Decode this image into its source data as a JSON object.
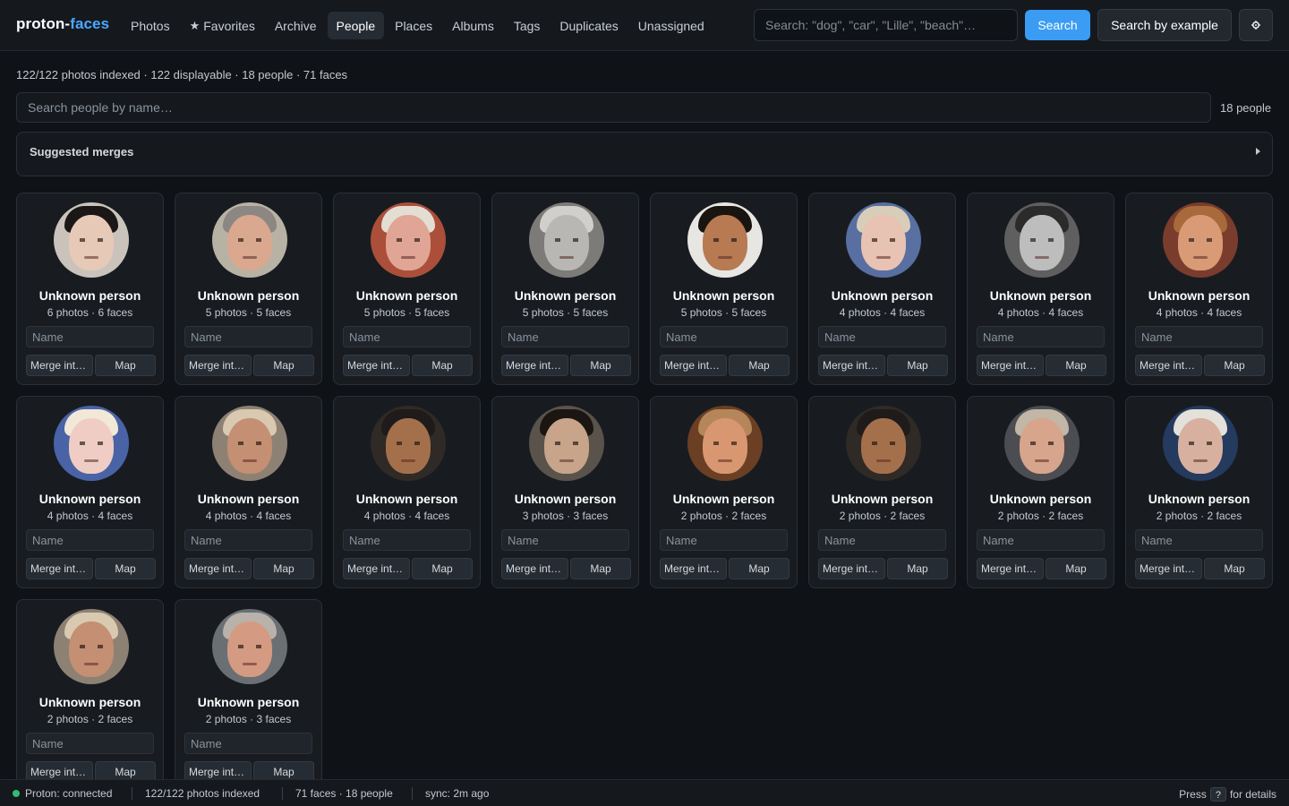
{
  "app": {
    "brand_main": "proton-",
    "brand_accent": "faces",
    "accent_color": "#4aa8ff"
  },
  "nav": [
    {
      "label": "Photos"
    },
    {
      "label": "Favorites",
      "icon": "star-icon"
    },
    {
      "label": "Archive"
    },
    {
      "label": "People",
      "active": true
    },
    {
      "label": "Places"
    },
    {
      "label": "Albums"
    },
    {
      "label": "Tags"
    },
    {
      "label": "Duplicates"
    },
    {
      "label": "Unassigned"
    }
  ],
  "search": {
    "placeholder": "Search: \"dog\", \"car\", \"Lille\", \"beach\"…",
    "button_label": "Search",
    "example_label": "Search by example",
    "settings_icon": "gear-icon"
  },
  "summary": {
    "line": "122/122 photos indexed · 122 displayable · 18 people · 71 faces",
    "people_search_placeholder": "Search people by name…",
    "people_count": "18 people"
  },
  "merges": {
    "title": "Suggested merges",
    "icon": "chevron-right-icon"
  },
  "card_labels": {
    "name_placeholder": "Name",
    "merge_label": "Merge into…",
    "map_label": "Map"
  },
  "people": [
    {
      "name": "Unknown person",
      "stats": "6 photos · 6 faces",
      "skin": "#e6c9b6",
      "hair": "#1c1717",
      "bg": "#c9c3bc"
    },
    {
      "name": "Unknown person",
      "stats": "5 photos · 5 faces",
      "skin": "#d9a88f",
      "hair": "#8c8782",
      "bg": "#b8b2a4"
    },
    {
      "name": "Unknown person",
      "stats": "5 photos · 5 faces",
      "skin": "#e0a594",
      "hair": "#e4ddd4",
      "bg": "#ab4f3a"
    },
    {
      "name": "Unknown person",
      "stats": "5 photos · 5 faces",
      "skin": "#b9b7b3",
      "hair": "#d1cfcb",
      "bg": "#7d7b78"
    },
    {
      "name": "Unknown person",
      "stats": "5 photos · 5 faces",
      "skin": "#b77a53",
      "hair": "#1a1410",
      "bg": "#e8e6e2"
    },
    {
      "name": "Unknown person",
      "stats": "4 photos · 4 faces",
      "skin": "#e8c2b3",
      "hair": "#d8cdb9",
      "bg": "#596ea1"
    },
    {
      "name": "Unknown person",
      "stats": "4 photos · 4 faces",
      "skin": "#bdbdbd",
      "hair": "#2b2b2b",
      "bg": "#5f5f5f"
    },
    {
      "name": "Unknown person",
      "stats": "4 photos · 4 faces",
      "skin": "#d99a76",
      "hair": "#a86a3a",
      "bg": "#7a3c2c"
    },
    {
      "name": "Unknown person",
      "stats": "4 photos · 4 faces",
      "skin": "#efcdc5",
      "hair": "#f2e8d8",
      "bg": "#4a63a6"
    },
    {
      "name": "Unknown person",
      "stats": "4 photos · 4 faces",
      "skin": "#c48f72",
      "hair": "#d9c9b0",
      "bg": "#8d8174"
    },
    {
      "name": "Unknown person",
      "stats": "4 photos · 4 faces",
      "skin": "#a4704c",
      "hair": "#1f1b1a",
      "bg": "#2f2a26"
    },
    {
      "name": "Unknown person",
      "stats": "3 photos · 3 faces",
      "skin": "#c7a48a",
      "hair": "#1c1612",
      "bg": "#5a534c"
    },
    {
      "name": "Unknown person",
      "stats": "2 photos · 2 faces",
      "skin": "#d99771",
      "hair": "#b5865a",
      "bg": "#6a3f24"
    },
    {
      "name": "Unknown person",
      "stats": "2 photos · 2 faces",
      "skin": "#a4704c",
      "hair": "#1f1b1a",
      "bg": "#2f2a26"
    },
    {
      "name": "Unknown person",
      "stats": "2 photos · 2 faces",
      "skin": "#d7a48c",
      "hair": "#c2b6a6",
      "bg": "#4b4d52"
    },
    {
      "name": "Unknown person",
      "stats": "2 photos · 2 faces",
      "skin": "#d8b0a0",
      "hair": "#e4e0da",
      "bg": "#243a5e"
    },
    {
      "name": "Unknown person",
      "stats": "2 photos · 2 faces",
      "skin": "#c48f72",
      "hair": "#d9c9b0",
      "bg": "#8d8174"
    },
    {
      "name": "Unknown person",
      "stats": "2 photos · 3 faces",
      "skin": "#d49a82",
      "hair": "#b8b2aa",
      "bg": "#6a6f74"
    }
  ],
  "status": {
    "connection": "Proton: connected",
    "connection_color": "#2fbf71",
    "indexed": "122/122 photos indexed",
    "faces": "71 faces · 18 people",
    "sync": "sync: 2m ago",
    "press": "Press",
    "key": "?",
    "details": "for details"
  }
}
